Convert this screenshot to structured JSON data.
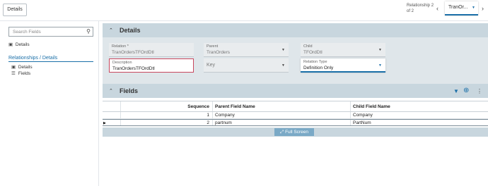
{
  "topbar": {
    "details_label": "Details",
    "relationship_label": "Relationship 2 of 2",
    "relationship_value": "TranOr...",
    "prev_icon": "chevron-left-icon",
    "next_icon": "chevron-right-icon"
  },
  "sidebar": {
    "search_placeholder": "Search Fields",
    "details_item": "Details",
    "group_label": "Relationships / Details",
    "sub_items": [
      {
        "label": "Details",
        "icon": "details-icon"
      },
      {
        "label": "Fields",
        "icon": "list-icon"
      }
    ]
  },
  "details_panel": {
    "title": "Details",
    "relation": {
      "label": "Relation *",
      "value": "TranOrdersTFOrdDtl"
    },
    "parent": {
      "label": "Parent",
      "value": "TranOrders"
    },
    "child": {
      "label": "Child",
      "value": "TFOrdDtl"
    },
    "description": {
      "label": "Description",
      "value": "TranOrdersTFOrdDtl"
    },
    "key": {
      "placeholder": "Key"
    },
    "relation_type": {
      "label": "Relation Type",
      "value": "Definition Only"
    }
  },
  "fields_panel": {
    "title": "Fields",
    "columns": [
      "Sequence",
      "Parent Field Name",
      "Child Field Name"
    ],
    "rows": [
      {
        "sequence": "1",
        "parent": "Company",
        "child": "Company"
      },
      {
        "sequence": "2",
        "parent": "partnum",
        "child": "PartNum"
      }
    ],
    "fullscreen_label": "Full Screen"
  },
  "colors": {
    "accent": "#1a6fa8",
    "panel_header": "#c8d6de",
    "error_border": "#c8475e"
  }
}
